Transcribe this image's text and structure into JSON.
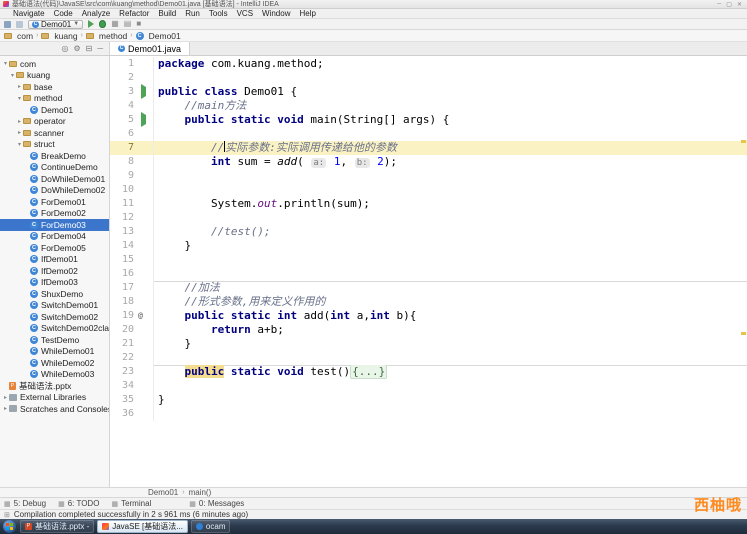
{
  "window": {
    "title": "基础语法(代码)\\JavaSE\\src\\com\\kuang\\method\\Demo01.java [基础语法] - IntelliJ IDEA"
  },
  "menu": {
    "items": [
      "Navigate",
      "Code",
      "Analyze",
      "Refactor",
      "Build",
      "Run",
      "Tools",
      "VCS",
      "Window",
      "Help"
    ]
  },
  "toolbar": {
    "run_config": "Demo01"
  },
  "navbar": {
    "items": [
      {
        "label": "com",
        "type": "pkg"
      },
      {
        "label": "kuang",
        "type": "pkg"
      },
      {
        "label": "method",
        "type": "pkg"
      },
      {
        "label": "Demo01",
        "type": "class"
      }
    ]
  },
  "editor_tab": {
    "label": "Demo01.java"
  },
  "project_tree": {
    "items": [
      {
        "label": "com",
        "type": "pkg",
        "indent": 0,
        "arrow": "▾"
      },
      {
        "label": "kuang",
        "type": "pkg",
        "indent": 1,
        "arrow": "▾"
      },
      {
        "label": "base",
        "type": "pkg",
        "indent": 2,
        "arrow": "▸"
      },
      {
        "label": "method",
        "type": "pkg",
        "indent": 2,
        "arrow": "▾"
      },
      {
        "label": "Demo01",
        "type": "class",
        "indent": 3
      },
      {
        "label": "operator",
        "type": "pkg",
        "indent": 2,
        "arrow": "▸"
      },
      {
        "label": "scanner",
        "type": "pkg",
        "indent": 2,
        "arrow": "▸"
      },
      {
        "label": "struct",
        "type": "pkg",
        "indent": 2,
        "arrow": "▾"
      },
      {
        "label": "BreakDemo",
        "type": "class",
        "indent": 3
      },
      {
        "label": "ContinueDemo",
        "type": "class",
        "indent": 3
      },
      {
        "label": "DoWhileDemo01",
        "type": "class",
        "indent": 3
      },
      {
        "label": "DoWhileDemo02",
        "type": "class",
        "indent": 3
      },
      {
        "label": "ForDemo01",
        "type": "class",
        "indent": 3
      },
      {
        "label": "ForDemo02",
        "type": "class",
        "indent": 3
      },
      {
        "label": "ForDemo03",
        "type": "class",
        "indent": 3,
        "selected": true
      },
      {
        "label": "ForDemo04",
        "type": "class",
        "indent": 3
      },
      {
        "label": "ForDemo05",
        "type": "class",
        "indent": 3
      },
      {
        "label": "IfDemo01",
        "type": "class",
        "indent": 3
      },
      {
        "label": "IfDemo02",
        "type": "class",
        "indent": 3
      },
      {
        "label": "IfDemo03",
        "type": "class",
        "indent": 3
      },
      {
        "label": "ShuxDemo",
        "type": "class",
        "indent": 3
      },
      {
        "label": "SwitchDemo01",
        "type": "class",
        "indent": 3
      },
      {
        "label": "SwitchDemo02",
        "type": "class",
        "indent": 3
      },
      {
        "label": "SwitchDemo02class",
        "type": "class",
        "indent": 3
      },
      {
        "label": "TestDemo",
        "type": "class",
        "indent": 3
      },
      {
        "label": "WhileDemo01",
        "type": "class",
        "indent": 3
      },
      {
        "label": "WhileDemo02",
        "type": "class",
        "indent": 3
      },
      {
        "label": "WhileDemo03",
        "type": "class",
        "indent": 3
      },
      {
        "label": "基础语法.pptx",
        "type": "file",
        "indent": 0
      },
      {
        "label": "External Libraries",
        "type": "lib",
        "indent": 0,
        "arrow": "▸"
      },
      {
        "label": "Scratches and Consoles",
        "type": "lib",
        "indent": 0,
        "arrow": "▸"
      }
    ]
  },
  "editor": {
    "lines": [
      {
        "n": "1",
        "tokens": [
          [
            "kw",
            "package "
          ],
          [
            "pl",
            "com.kuang.method;"
          ]
        ]
      },
      {
        "n": "2",
        "tokens": []
      },
      {
        "n": "3",
        "gutter": "run",
        "tokens": [
          [
            "kw",
            "public class "
          ],
          [
            "pl",
            "Demo01 {"
          ]
        ]
      },
      {
        "n": "4",
        "tokens": [
          [
            "pl",
            "    "
          ],
          [
            "cm",
            "//main方法"
          ]
        ]
      },
      {
        "n": "5",
        "gutter": "run",
        "tokens": [
          [
            "pl",
            "    "
          ],
          [
            "kw",
            "public static void "
          ],
          [
            "pl",
            "main(String[] args) {"
          ]
        ]
      },
      {
        "n": "6",
        "tokens": []
      },
      {
        "n": "7",
        "hl": true,
        "tokens": [
          [
            "pl",
            "        "
          ],
          [
            "cm",
            "//"
          ],
          [
            "caret",
            ""
          ],
          [
            "cm",
            "实际参数:实际调用传递给他的参数"
          ]
        ]
      },
      {
        "n": "8",
        "tokens": [
          [
            "pl",
            "        "
          ],
          [
            "kw",
            "int"
          ],
          [
            "pl",
            " sum = "
          ],
          [
            "it",
            "add"
          ],
          [
            "pl",
            "( "
          ],
          [
            "hint",
            "a:"
          ],
          [
            "pl",
            " "
          ],
          [
            "num",
            "1"
          ],
          [
            "pl",
            ", "
          ],
          [
            "hint",
            "b:"
          ],
          [
            "pl",
            " "
          ],
          [
            "num",
            "2"
          ],
          [
            "pl",
            ");"
          ]
        ]
      },
      {
        "n": "9",
        "tokens": []
      },
      {
        "n": "10",
        "tokens": []
      },
      {
        "n": "11",
        "tokens": [
          [
            "pl",
            "        System."
          ],
          [
            "field",
            "out"
          ],
          [
            "pl",
            ".println(sum);"
          ]
        ]
      },
      {
        "n": "12",
        "tokens": []
      },
      {
        "n": "13",
        "tokens": [
          [
            "pl",
            "        "
          ],
          [
            "cm",
            "//test();"
          ]
        ]
      },
      {
        "n": "14",
        "tokens": [
          [
            "pl",
            "    }"
          ]
        ]
      },
      {
        "n": "15",
        "tokens": []
      },
      {
        "n": "16",
        "tokens": []
      },
      {
        "n": "17",
        "sep": true,
        "tokens": [
          [
            "pl",
            "    "
          ],
          [
            "cm",
            "//加法"
          ]
        ]
      },
      {
        "n": "18",
        "tokens": [
          [
            "pl",
            "    "
          ],
          [
            "cm",
            "//形式参数,用来定义作用的"
          ]
        ]
      },
      {
        "n": "19",
        "gutter": "at",
        "tokens": [
          [
            "pl",
            "    "
          ],
          [
            "kw",
            "public static int "
          ],
          [
            "pl",
            "add("
          ],
          [
            "kw",
            "int"
          ],
          [
            "pl",
            " a,"
          ],
          [
            "kw",
            "int"
          ],
          [
            "pl",
            " b){"
          ]
        ]
      },
      {
        "n": "20",
        "tokens": [
          [
            "pl",
            "        "
          ],
          [
            "kw",
            "return"
          ],
          [
            "pl",
            " a+b;"
          ]
        ]
      },
      {
        "n": "21",
        "tokens": [
          [
            "pl",
            "    }"
          ]
        ]
      },
      {
        "n": "22",
        "tokens": []
      },
      {
        "n": "23",
        "sep": true,
        "tokens": [
          [
            "pl",
            "    "
          ],
          [
            "kwhl",
            "public"
          ],
          [
            "kw",
            " static void "
          ],
          [
            "pl",
            "test()"
          ],
          [
            "fold",
            "{...}"
          ]
        ]
      },
      {
        "n": "34",
        "tokens": []
      },
      {
        "n": "35",
        "tokens": [
          [
            "pl",
            "}"
          ]
        ]
      },
      {
        "n": "36",
        "tokens": []
      }
    ]
  },
  "breadcrumbs": {
    "items": [
      "Demo01",
      "main()"
    ]
  },
  "tool_windows": {
    "items": [
      {
        "label": "5: Debug"
      },
      {
        "label": "6: TODO"
      },
      {
        "label": "Terminal"
      },
      {
        "label": "0: Messages",
        "gap": true
      }
    ]
  },
  "status_bar": {
    "message": "Compilation completed successfully in 2 s 961 ms (6 minutes ago)"
  },
  "watermark": {
    "text": "西柚哦"
  },
  "taskbar": {
    "items": [
      {
        "label": "基础语法.pptx -",
        "type": "ppt"
      },
      {
        "label": "JavaSE [基础语法...",
        "type": "idea",
        "active": true
      },
      {
        "label": "ocam",
        "type": "ocam"
      }
    ]
  },
  "colors": {
    "accent_run": "#4fa357",
    "selection": "#3c76cc",
    "caret_line": "#fbf2c3",
    "watermark": "#ff8a1e"
  }
}
